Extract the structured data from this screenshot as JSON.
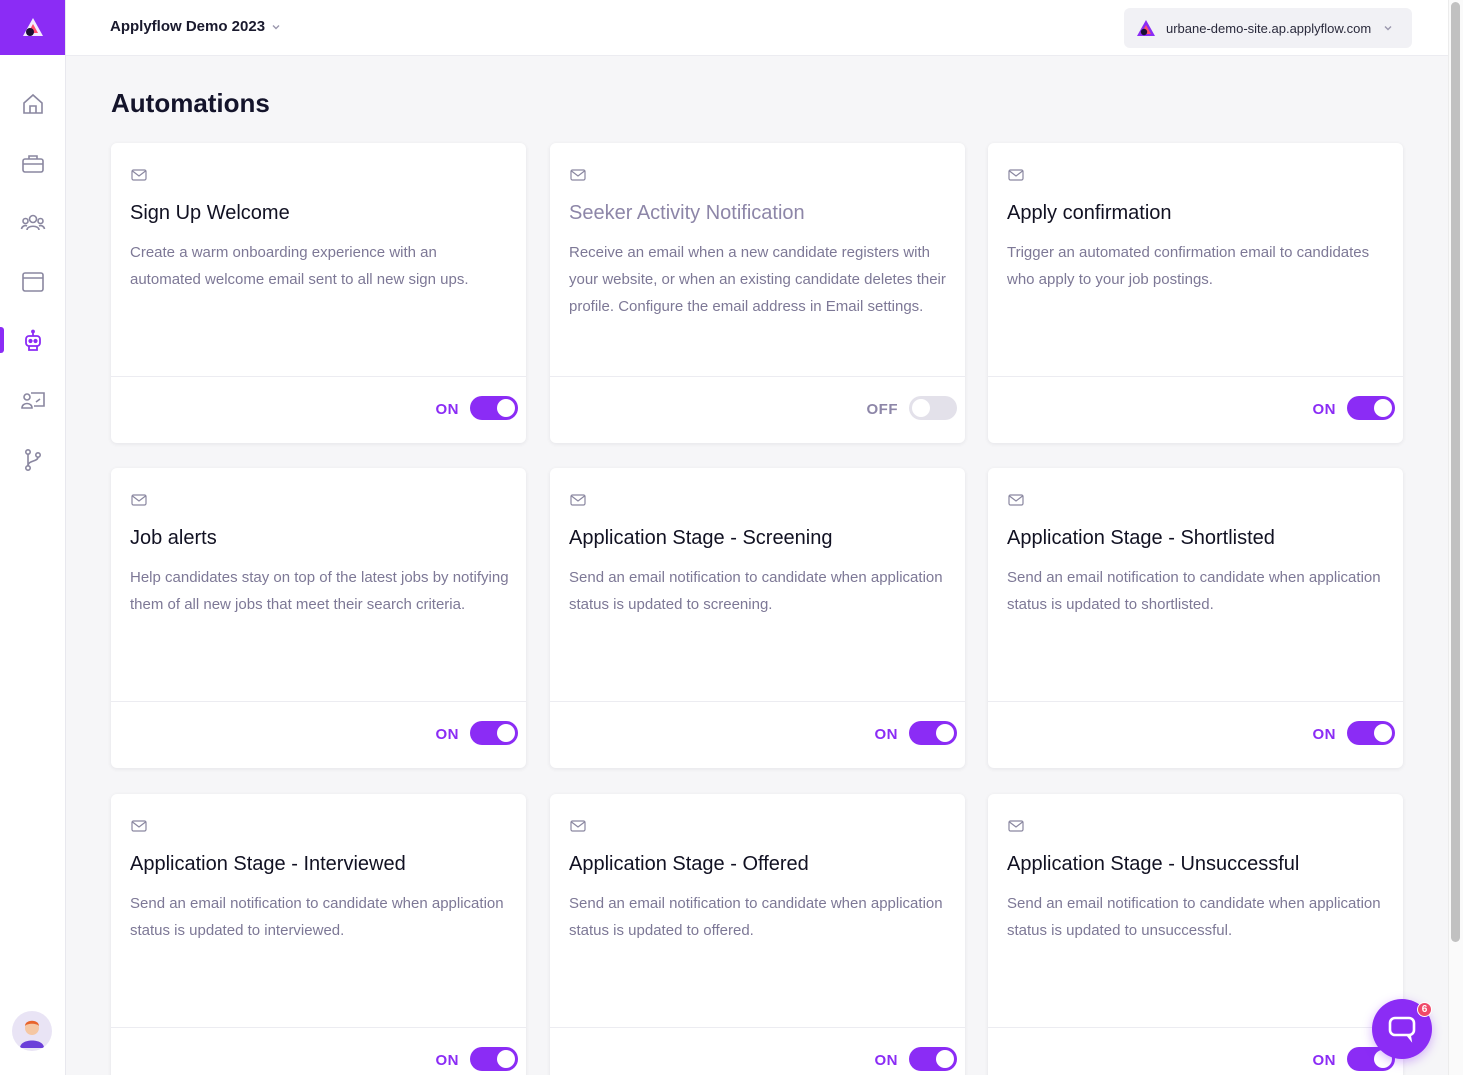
{
  "header": {
    "workspace": "Applyflow Demo 2023",
    "site": "urbane-demo-site.ap.applyflow.com"
  },
  "sidebar": {
    "items": [
      {
        "name": "home-icon"
      },
      {
        "name": "briefcase-icon"
      },
      {
        "name": "users-icon"
      },
      {
        "name": "window-icon"
      },
      {
        "name": "robot-icon",
        "active": true
      },
      {
        "name": "user-card-icon"
      },
      {
        "name": "git-branch-icon"
      }
    ]
  },
  "page": {
    "title": "Automations"
  },
  "cards": [
    {
      "title": "Sign Up Welcome",
      "description": "Create a warm onboarding experience with an automated welcome email sent to all new sign ups.",
      "state": "ON",
      "enabled": true
    },
    {
      "title": "Seeker Activity Notification",
      "description": "Receive an email when a new candidate registers with your website, or when an existing candidate deletes their profile. Configure the email address in Email settings.",
      "state": "OFF",
      "enabled": false
    },
    {
      "title": "Apply confirmation",
      "description": "Trigger an automated confirmation email to candidates who apply to your job postings.",
      "state": "ON",
      "enabled": true
    },
    {
      "title": "Job alerts",
      "description": "Help candidates stay on top of the latest jobs by notifying them of all new jobs that meet their search criteria.",
      "state": "ON",
      "enabled": true
    },
    {
      "title": "Application Stage - Screening",
      "description": "Send an email notification to candidate when application status is updated to screening.",
      "state": "ON",
      "enabled": true
    },
    {
      "title": "Application Stage - Shortlisted",
      "description": "Send an email notification to candidate when application status is updated to shortlisted.",
      "state": "ON",
      "enabled": true
    },
    {
      "title": "Application Stage - Interviewed",
      "description": "Send an email notification to candidate when application status is updated to interviewed.",
      "state": "ON",
      "enabled": true
    },
    {
      "title": "Application Stage - Offered",
      "description": "Send an email notification to candidate when application status is updated to offered.",
      "state": "ON",
      "enabled": true
    },
    {
      "title": "Application Stage - Unsuccessful",
      "description": "Send an email notification to candidate when application status is updated to unsuccessful.",
      "state": "ON",
      "enabled": true
    }
  ],
  "chat": {
    "badge": "6"
  },
  "colors": {
    "accent": "#8b2cf5",
    "toggle_off": "#e3e1ea",
    "muted_text": "#7d7896"
  }
}
